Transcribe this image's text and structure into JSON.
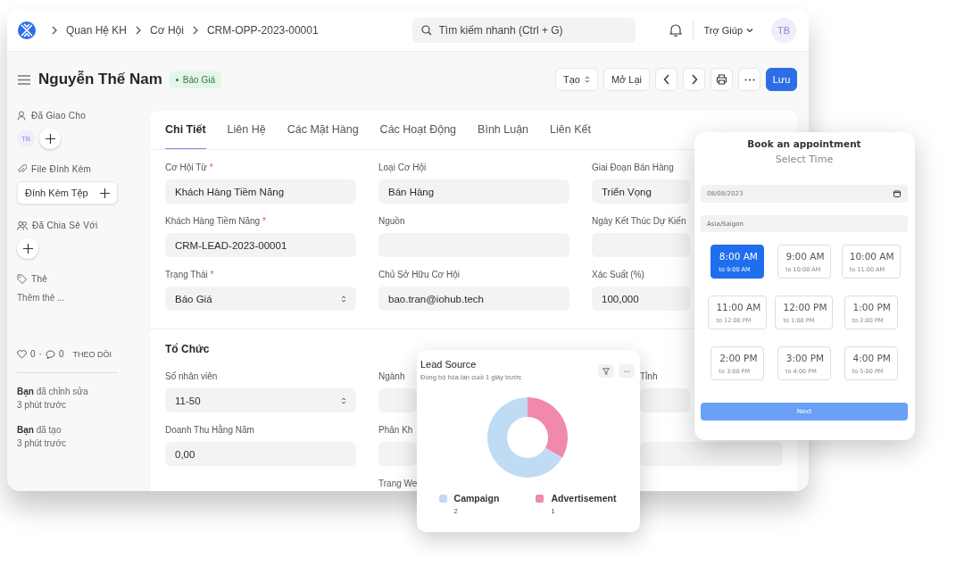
{
  "breadcrumbs": [
    "Quan Hệ KH",
    "Cơ Hội",
    "CRM-OPP-2023-00001"
  ],
  "search": {
    "placeholder": "Tìm kiếm nhanh (Ctrl + G)"
  },
  "help_menu": "Trợ Giúp",
  "avatar": "TB",
  "page": {
    "title": "Nguyễn Thế Nam",
    "status": "Báo Giá"
  },
  "actions": [
    {
      "kind": "dropdown",
      "label": "Tạo"
    },
    {
      "kind": "text",
      "label": "Mở Lại"
    },
    {
      "kind": "prev"
    },
    {
      "kind": "next"
    },
    {
      "kind": "print"
    },
    {
      "kind": "more"
    },
    {
      "kind": "primary",
      "label": "Lưu"
    }
  ],
  "required_marker": "*",
  "sidebar": {
    "assigned_title": "Đã Giao Cho",
    "assignees": [
      "TB"
    ],
    "attachments_title": "File Đính Kèm",
    "attach_button": "Đính Kèm Tệp",
    "shared_title": "Đã Chia Sẻ Với",
    "tags_title": "Thẻ",
    "tags_placeholder": "Thêm thẻ ...",
    "likes": "0",
    "separator": "·",
    "comments": "0",
    "follow": "THEO DÕI",
    "activity": [
      {
        "text": "**Bạn** đã chỉnh sửa",
        "time": "3 phút trước"
      },
      {
        "text": "**Bạn** đã tạo",
        "time": "3 phút trước"
      }
    ]
  },
  "tabs": [
    {
      "label": "Chi Tiết",
      "selected": true
    },
    {
      "label": "Liên Hệ",
      "selected": false
    },
    {
      "label": "Các Mặt Hàng",
      "selected": false
    },
    {
      "label": "Các Hoạt Động",
      "selected": false
    },
    {
      "label": "Bình Luận",
      "selected": false
    },
    {
      "label": "Liên Kết",
      "selected": false
    }
  ],
  "details": [
    {
      "label": "Cơ Hội Từ",
      "required": true,
      "kind": "text",
      "value": "Khách Hàng Tiềm Năng"
    },
    {
      "label": "Loại Cơ Hội",
      "required": false,
      "kind": "text",
      "value": "Bán Hàng"
    },
    {
      "label": "Giai Đoạn Bán Hàng",
      "required": false,
      "kind": "text",
      "value": "Triển Vọng"
    },
    {
      "label": "Khách Hàng Tiềm Năng",
      "required": true,
      "kind": "text",
      "value": "CRM-LEAD-2023-00001"
    },
    {
      "label": "Nguồn",
      "required": false,
      "kind": "text"
    },
    {
      "label": "Ngày Kết Thúc Dự Kiến",
      "required": false,
      "kind": "text"
    },
    {
      "label": "Trạng Thái",
      "required": true,
      "kind": "select",
      "value": "Báo Giá"
    },
    {
      "label": "Chủ Sở Hữu Cơ Hội",
      "required": false,
      "kind": "text",
      "value": "bao.tran@iohub.tech"
    },
    {
      "label": "Xác Suất (%)",
      "required": false,
      "kind": "text",
      "value": "100,000"
    }
  ],
  "organization": {
    "title": "Tổ Chức",
    "fields": [
      {
        "label": "Số nhân viên",
        "required": false,
        "kind": "select",
        "value": "11-50"
      },
      {
        "label": "Ngành",
        "required": false,
        "kind": "text"
      },
      {
        "label": "Tỉnh",
        "required": false,
        "kind": "text"
      },
      {
        "label": "Doanh Thu Hằng Năm",
        "required": false,
        "kind": "text",
        "value": "0,00"
      },
      {
        "label": "Phân Kh",
        "required": false,
        "kind": "text"
      },
      {
        "kind": "text"
      },
      {
        "label": "Trang We",
        "required": false,
        "kind": "label"
      }
    ]
  },
  "lead_source": {
    "title": "Lead Source",
    "subtitle": "Đồng bộ hóa lần cuối 1 giây trước",
    "legend": [
      {
        "count": "2",
        "color": "#c0dcf5"
      },
      {
        "count": "1",
        "color": "#f089ac"
      }
    ],
    "chart_data": {
      "type": "donut",
      "categories": [
        "Campaign",
        "Advertisement"
      ],
      "values": [
        66.7,
        33.3
      ]
    }
  },
  "appointment": {
    "title": "Book an appointment",
    "subtitle": "Select Time",
    "date": "08/08/2023",
    "timezone": "Asia/Saigon",
    "slots": [
      {
        "time": "8:00 AM",
        "until": "to 9:00 AM",
        "selected": true
      },
      {
        "time": "9:00 AM",
        "until": "to 10:00 AM",
        "selected": false
      },
      {
        "time": "10:00 AM",
        "until": "to 11:00 AM",
        "selected": false
      },
      {
        "time": "11:00 AM",
        "until": "to 12:00 PM",
        "selected": false
      },
      {
        "time": "12:00 PM",
        "until": "to 1:00 PM",
        "selected": false
      },
      {
        "time": "1:00 PM",
        "until": "to 2:00 PM",
        "selected": false
      },
      {
        "time": "2:00 PM",
        "until": "to 3:00 PM",
        "selected": false
      },
      {
        "time": "3:00 PM",
        "until": "to 4:00 PM",
        "selected": false
      },
      {
        "time": "4:00 PM",
        "until": "to 5:00 PM",
        "selected": false
      }
    ],
    "next_button": "Next"
  }
}
